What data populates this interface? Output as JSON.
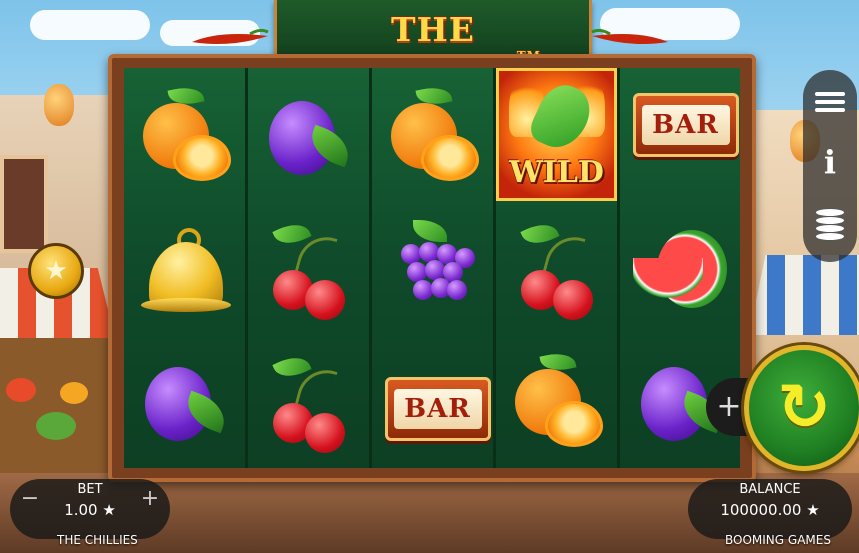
{
  "game": {
    "title": "THE CHILLIES",
    "trademark": "TM",
    "provider": "BOOMING GAMES"
  },
  "reels": [
    [
      "orange",
      "bell",
      "plum"
    ],
    [
      "plum",
      "cherries",
      "cherries"
    ],
    [
      "orange",
      "grapes",
      "bar"
    ],
    [
      "wild",
      "cherries",
      "orange"
    ],
    [
      "bar",
      "watermelon",
      "plum"
    ]
  ],
  "symbol_text": {
    "bar": "BAR",
    "wild": "WILD"
  },
  "controls": {
    "bet_label": "BET",
    "bet_value": "1.00 ★",
    "bet_minus": "−",
    "bet_plus": "+",
    "balance_label": "BALANCE",
    "balance_value": "100000.00 ★",
    "game_name_footer": "THE CHILLIES",
    "autoplay_plus": "+",
    "spin_icon": "spin-arrow-icon",
    "coin_button_icon": "star-coin-icon",
    "menu_icon": "menu-icon",
    "info_icon": "info-icon",
    "info_glyph": "i",
    "coins_icon": "coins-stack-icon"
  },
  "colors": {
    "reel_bg": "#0f4a2a",
    "frame": "#7a3f1f",
    "title_gold": "#ffd94a",
    "spin_green": "#1f7f22",
    "spin_arrow": "#f4ee2a"
  }
}
